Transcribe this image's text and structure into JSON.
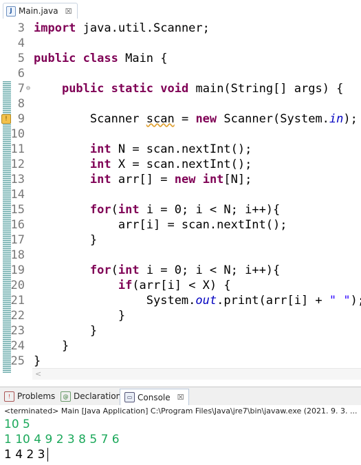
{
  "editor_tab": {
    "title": "Main.java",
    "icon": "java-file-icon",
    "close": "☒"
  },
  "code_lines": [
    {
      "num": "3",
      "text": "import java.util.Scanner;"
    },
    {
      "num": "4",
      "text": ""
    },
    {
      "num": "5",
      "text": "public class Main {"
    },
    {
      "num": "6",
      "text": ""
    },
    {
      "num": "7",
      "text": "    public static void main(String[] args) {"
    },
    {
      "num": "8",
      "text": ""
    },
    {
      "num": "9",
      "text": "        Scanner scan = new Scanner(System.in);"
    },
    {
      "num": "10",
      "text": ""
    },
    {
      "num": "11",
      "text": "        int N = scan.nextInt();"
    },
    {
      "num": "12",
      "text": "        int X = scan.nextInt();"
    },
    {
      "num": "13",
      "text": "        int arr[] = new int[N];"
    },
    {
      "num": "14",
      "text": ""
    },
    {
      "num": "15",
      "text": "        for(int i = 0; i < N; i++){"
    },
    {
      "num": "16",
      "text": "            arr[i] = scan.nextInt();"
    },
    {
      "num": "17",
      "text": "        }"
    },
    {
      "num": "18",
      "text": ""
    },
    {
      "num": "19",
      "text": "        for(int i = 0; i < N; i++){"
    },
    {
      "num": "20",
      "text": "            if(arr[i] < X) {"
    },
    {
      "num": "21",
      "text": "                System.out.print(arr[i] + \" \");"
    },
    {
      "num": "22",
      "text": "            }"
    },
    {
      "num": "23",
      "text": "        }"
    },
    {
      "num": "24",
      "text": "    }"
    },
    {
      "num": "25",
      "text": "}"
    }
  ],
  "panel": {
    "tabs": [
      {
        "label": "Problems",
        "icon": "problems-icon"
      },
      {
        "label": "Declaration",
        "icon": "declaration-icon"
      },
      {
        "label": "Console",
        "icon": "console-icon"
      }
    ],
    "console_header": "<terminated> Main [Java Application] C:\\Program Files\\Java\\jre7\\bin\\javaw.exe (2021. 9. 3. ...",
    "input_lines": [
      "10 5",
      "1 10 4 9 2 3 8 5 7 6"
    ],
    "output_line": "1 4 2 3"
  },
  "colors": {
    "keyword": "#7f0055",
    "field": "#0000c0",
    "string": "#2a00ff",
    "console_input": "#1ba85a"
  }
}
